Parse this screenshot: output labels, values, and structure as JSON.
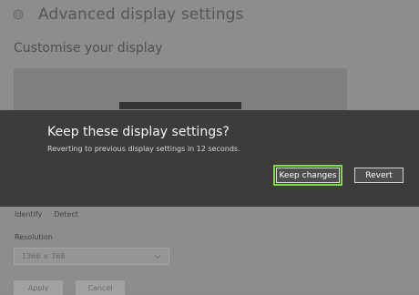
{
  "window": {
    "title": "Advanced display settings"
  },
  "section": {
    "heading": "Customise your display"
  },
  "dialog": {
    "title": "Keep these display settings?",
    "message": "Reverting to previous display settings in 12 seconds.",
    "keep_label": "Keep changes",
    "revert_label": "Revert"
  },
  "links": {
    "identify": "Identify",
    "detect": "Detect"
  },
  "resolution": {
    "label": "Resolution",
    "value": "1366 × 768"
  },
  "actions": {
    "apply": "Apply",
    "cancel": "Cancel"
  },
  "colors": {
    "highlight": "#7be03f"
  },
  "icons": {
    "settings": "gear-icon",
    "dropdown": "chevron-down-icon"
  }
}
